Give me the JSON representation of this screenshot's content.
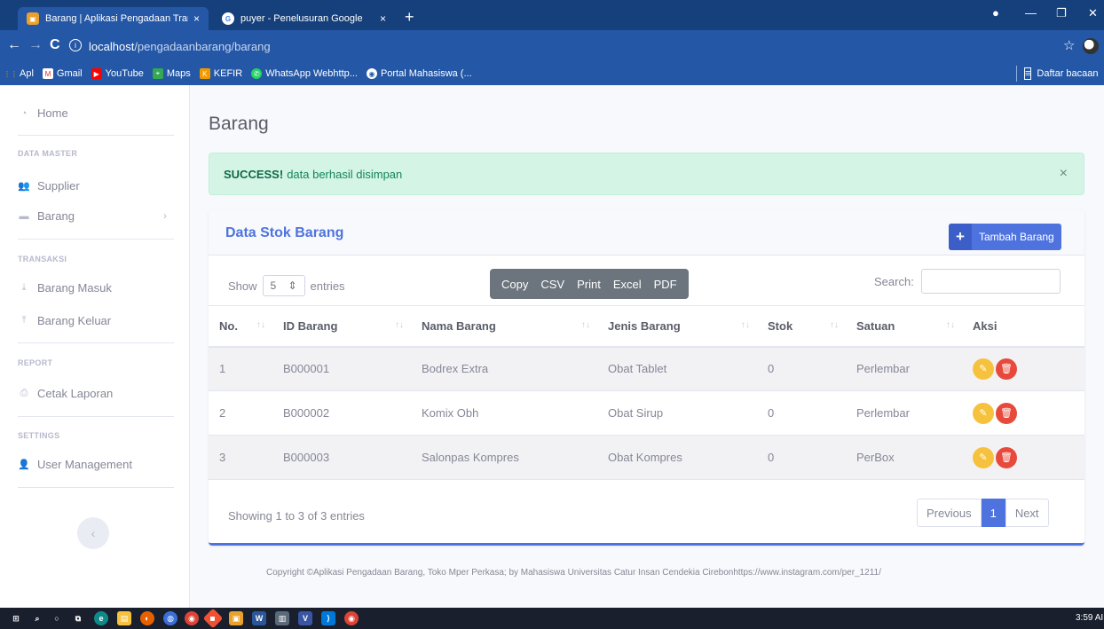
{
  "browser": {
    "tabs": [
      {
        "title": "Barang | Aplikasi Pengadaan Tran",
        "close": "×",
        "icon": "app-favicon"
      },
      {
        "title": "puyer - Penelusuran Google",
        "close": "×",
        "icon": "google-favicon"
      }
    ],
    "new_tab": "+",
    "url_host": "localhost",
    "url_path": "/pengadaanbarang/barang",
    "bookmarks": [
      "Apl",
      "Gmail",
      "YouTube",
      "Maps",
      "KEFIR",
      "WhatsApp Webhttp...",
      "Portal Mahasiswa (..."
    ],
    "reading_list": "Daftar bacaan"
  },
  "sidebar": {
    "home": "Home",
    "heading_master": "DATA MASTER",
    "supplier": "Supplier",
    "barang": "Barang",
    "heading_transaksi": "TRANSAKSI",
    "barang_masuk": "Barang Masuk",
    "barang_keluar": "Barang Keluar",
    "heading_report": "REPORT",
    "cetak_laporan": "Cetak Laporan",
    "heading_settings": "SETTINGS",
    "user_management": "User Management",
    "collapse": "‹"
  },
  "main": {
    "page_title": "Barang",
    "alert_strong": "SUCCESS!",
    "alert_text": "data berhasil disimpan",
    "alert_close": "×",
    "card_title": "Data Stok Barang",
    "add_button": "Tambah Barang",
    "show_label": "Show",
    "entries_label": "entries",
    "page_length": "5",
    "export": [
      "Copy",
      "CSV",
      "Print",
      "Excel",
      "PDF"
    ],
    "search_label": "Search:",
    "columns": [
      "No.",
      "ID Barang",
      "Nama Barang",
      "Jenis Barang",
      "Stok",
      "Satuan",
      "Aksi"
    ],
    "rows": [
      [
        "1",
        "B000001",
        "Bodrex Extra",
        "Obat Tablet",
        "0",
        "Perlembar"
      ],
      [
        "2",
        "B000002",
        "Komix Obh",
        "Obat Sirup",
        "0",
        "Perlembar"
      ],
      [
        "3",
        "B000003",
        "Salonpas Kompres",
        "Obat Kompres",
        "0",
        "PerBox"
      ]
    ],
    "info": "Showing 1 to 3 of 3 entries",
    "pagination": {
      "previous": "Previous",
      "current": "1",
      "next": "Next"
    }
  },
  "footer": "Copyright ©Aplikasi Pengadaan Barang, Toko Mper Perkasa; by Mahasiswa Universitas Catur Insan Cendekia Cirebonhttps://www.instagram.com/per_1211/",
  "taskbar": {
    "time": "3:59 AI"
  },
  "colors": {
    "primary": "#4e73df",
    "success_bg": "#d4f4e6",
    "warning": "#f6c23e",
    "danger": "#e74a3b",
    "chrome": "#2457a6"
  }
}
